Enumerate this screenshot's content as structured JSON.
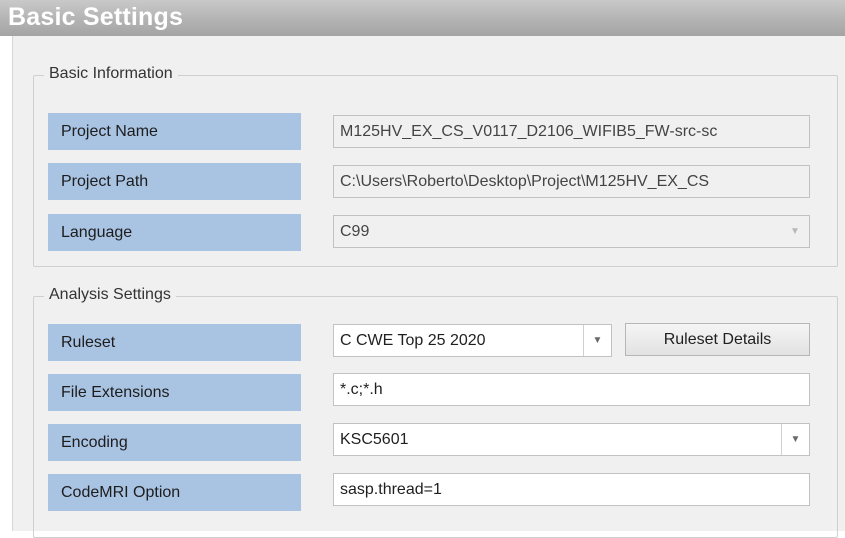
{
  "title": "Basic Settings",
  "basic_info": {
    "legend": "Basic Information",
    "project_name": {
      "label": "Project Name",
      "value": "M125HV_EX_CS_V0117_D2106_WIFIB5_FW-src-sc"
    },
    "project_path": {
      "label": "Project Path",
      "value": "C:\\Users\\Roberto\\Desktop\\Project\\M125HV_EX_CS"
    },
    "language": {
      "label": "Language",
      "value": "C99"
    }
  },
  "analysis": {
    "legend": "Analysis Settings",
    "ruleset": {
      "label": "Ruleset",
      "value": "C CWE Top 25 2020",
      "details_button": "Ruleset Details"
    },
    "file_extensions": {
      "label": "File Extensions",
      "value": "*.c;*.h"
    },
    "encoding": {
      "label": "Encoding",
      "value": "KSC5601"
    },
    "codemri_option": {
      "label": "CodeMRI Option",
      "value": "sasp.thread=1"
    }
  },
  "icons": {
    "dropdown": "chevron-down-icon"
  },
  "colors": {
    "title_bar": "#b3b3b3",
    "label_background": "#a9c3e2",
    "panel_background": "#f0f0f0"
  }
}
